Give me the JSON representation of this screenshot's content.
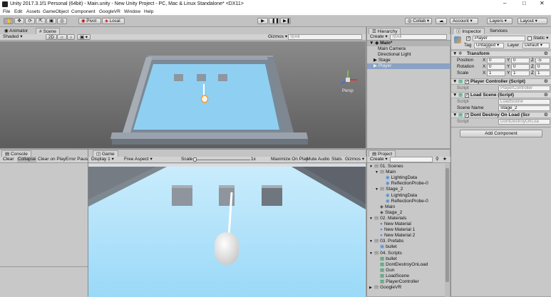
{
  "window": {
    "title": "Unity 2017.3.1f1 Personal (64bit) - Main.unity - New Unity Project - PC, Mac & Linux Standalone* <DX11>"
  },
  "menu": [
    "File",
    "Edit",
    "Assets",
    "GameObject",
    "Component",
    "GoogleVR",
    "Window",
    "Help"
  ],
  "toolbar": {
    "pivot": "Pivot",
    "local": "Local",
    "collab": "Collab",
    "account": "Account",
    "layers": "Layers",
    "layout": "Layout"
  },
  "scene_tabs": {
    "animator": "Animator",
    "scene": "Scene"
  },
  "scene_bar": {
    "shaded": "Shaded",
    "mode2d": "2D",
    "gizmos": "Gizmos",
    "search": "ⓆAll"
  },
  "gizmo": {
    "persp": "Persp"
  },
  "hierarchy": {
    "tab": "Hierarchy",
    "create": "Create",
    "search": "ⓆAll",
    "items": [
      "Main*",
      "Main Camera",
      "Directional Light",
      "Stage",
      "Player"
    ]
  },
  "inspector": {
    "tabs": [
      "Inspector",
      "Services"
    ],
    "name": "Player",
    "static": "Static",
    "tag_label": "Tag",
    "tag": "Untagged",
    "layer_label": "Layer",
    "layer": "Default",
    "transform": {
      "title": "Transform",
      "rows": [
        {
          "label": "Position",
          "x": "0",
          "y": "0",
          "z": "-5"
        },
        {
          "label": "Rotation",
          "x": "0",
          "y": "0",
          "z": "0"
        },
        {
          "label": "Scale",
          "x": "1",
          "y": "1",
          "z": "1"
        }
      ]
    },
    "components": [
      {
        "title": "Player Controller (Script)",
        "script_label": "Script",
        "script": "PlayerController"
      },
      {
        "title": "Load Scene (Script)",
        "script_label": "Script",
        "script": "LoadScene",
        "extra_label": "Scene Name",
        "extra": "Stage_2"
      },
      {
        "title": "Dont Destroy On Load (Scr",
        "script_label": "Script",
        "script": "DontDestroyOnLoa"
      }
    ],
    "add_component": "Add Component"
  },
  "console": {
    "tab": "Console",
    "buttons": [
      "Clear",
      "Collapse",
      "Clear on Play",
      "Error Pause"
    ]
  },
  "game": {
    "tab": "Game",
    "display": "Display 1",
    "aspect": "Free Aspect",
    "scale_label": "Scale",
    "scale_value": "1x",
    "buttons": [
      "Maximize On Play",
      "Mute Audio",
      "Stats",
      "Gizmos"
    ]
  },
  "project": {
    "tab": "Project",
    "create": "Create",
    "items": [
      {
        "label": "01. Scenes",
        "depth": 0,
        "kind": "folder",
        "arrow": "▼"
      },
      {
        "label": "Main",
        "depth": 1,
        "kind": "folder",
        "arrow": "▼"
      },
      {
        "label": "LightingData",
        "depth": 2,
        "kind": "asset",
        "arrow": ""
      },
      {
        "label": "ReflectionProbe-0",
        "depth": 2,
        "kind": "asset",
        "arrow": ""
      },
      {
        "label": "Stage_2",
        "depth": 1,
        "kind": "folder",
        "arrow": "▼"
      },
      {
        "label": "LightingData",
        "depth": 2,
        "kind": "asset",
        "arrow": ""
      },
      {
        "label": "ReflectionProbe-0",
        "depth": 2,
        "kind": "asset",
        "arrow": ""
      },
      {
        "label": "Main",
        "depth": 1,
        "kind": "unity",
        "arrow": ""
      },
      {
        "label": "Stage_2",
        "depth": 1,
        "kind": "unity",
        "arrow": ""
      },
      {
        "label": "02. Materials",
        "depth": 0,
        "kind": "folder",
        "arrow": "▼"
      },
      {
        "label": "New Material",
        "depth": 1,
        "kind": "mat",
        "arrow": ""
      },
      {
        "label": "New Material 1",
        "depth": 1,
        "kind": "mat",
        "arrow": ""
      },
      {
        "label": "New Material 2",
        "depth": 1,
        "kind": "mat",
        "arrow": ""
      },
      {
        "label": "03. Prefabs",
        "depth": 0,
        "kind": "folder",
        "arrow": "▼"
      },
      {
        "label": "bullet",
        "depth": 1,
        "kind": "prefab",
        "arrow": ""
      },
      {
        "label": "04. Scripts",
        "depth": 0,
        "kind": "folder",
        "arrow": "▼"
      },
      {
        "label": "bullet",
        "depth": 1,
        "kind": "script",
        "arrow": ""
      },
      {
        "label": "DontDestroyOnLoad",
        "depth": 1,
        "kind": "script",
        "arrow": ""
      },
      {
        "label": "Gun",
        "depth": 1,
        "kind": "script",
        "arrow": ""
      },
      {
        "label": "LoadScene",
        "depth": 1,
        "kind": "script",
        "arrow": ""
      },
      {
        "label": "PlayerController",
        "depth": 1,
        "kind": "script",
        "arrow": ""
      },
      {
        "label": "GoogleVR",
        "depth": 0,
        "kind": "folder",
        "arrow": "▶"
      }
    ]
  }
}
